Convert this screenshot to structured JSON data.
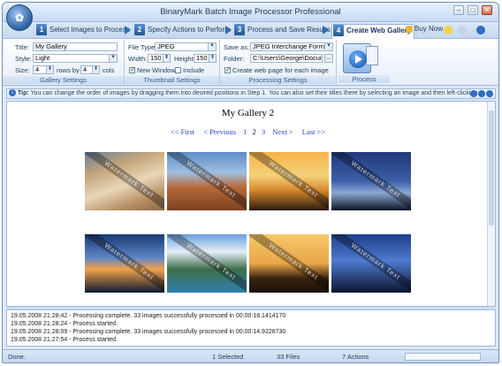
{
  "window": {
    "title": "BinaryMark Batch Image Processor Professional"
  },
  "steps": [
    {
      "num": "1",
      "label": "Select Images to Process"
    },
    {
      "num": "2",
      "label": "Specify Actions to Perform"
    },
    {
      "num": "3",
      "label": "Process and Save Results"
    },
    {
      "num": "4",
      "label": "Create Web Gallery"
    }
  ],
  "buy_now": "Buy Now",
  "gallery_settings": {
    "title_label": "Title:",
    "title_value": "My Gallery",
    "style_label": "Style:",
    "style_value": "Light",
    "size_label": "Size:",
    "rows_value": "4",
    "rows_label": "rows by",
    "cols_value": "4",
    "cols_label": "cols",
    "group_label": "Gallery Settings"
  },
  "thumbnail_settings": {
    "filetype_label": "File Type:",
    "filetype_value": "JPEG",
    "width_label": "Width:",
    "width_value": "150",
    "height_label": "Height:",
    "height_value": "150",
    "new_window_label": "New Window",
    "include_titles_label": "Include Titles",
    "group_label": "Thumbnail Settings"
  },
  "processing_settings": {
    "saveas_label": "Save as:",
    "saveas_value": "JPEG Interchange Format (",
    "folder_label": "Folder:",
    "folder_value": "C:\\Users\\George\\Documents",
    "browse_label": "...",
    "create_web_label": "Create web page for each image",
    "group_label": "Processing Settings"
  },
  "process": {
    "label": "Process"
  },
  "tip": {
    "prefix": "Tip:",
    "text": "You can change the order of images by dragging them into desired positions in Step 1. You can also set their titles there by selecting an image and then left-clicking..."
  },
  "gallery": {
    "title": "My Gallery 2",
    "first": "<< First",
    "previous": "< Previous",
    "pages": [
      "1",
      "2",
      "3"
    ],
    "current_page": "2",
    "next": "Next >",
    "last": "Last >>",
    "watermark": "Watermark Text"
  },
  "log": [
    "19.05.2008 21:28:42 - Processing complete. 33 images successfully processed in 00:00:18.1414170",
    "19.05.2008 21:28:24 - Process started.",
    "19.05.2008 21:28:09 - Processing complete. 33 images successfully processed in 00:00:14.9228730",
    "19.05.2008 21:27:54 - Process started."
  ],
  "status": {
    "state": "Done.",
    "selected": "1 Selected",
    "files": "33 Files",
    "actions": "7 Actions"
  },
  "colors": {
    "accent": "#2e6cb5",
    "link": "#2a43c8",
    "frame": "#dde9f7"
  }
}
